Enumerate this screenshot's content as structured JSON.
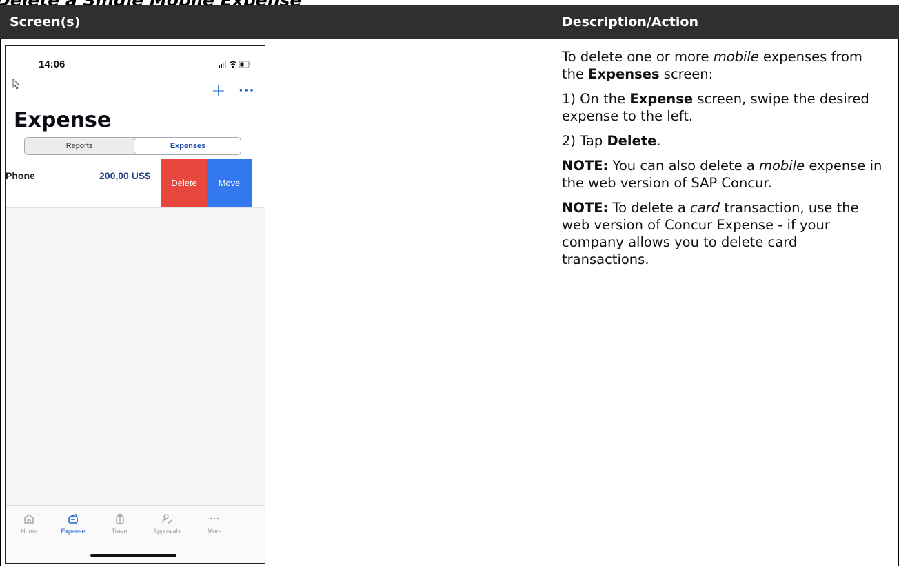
{
  "section_heading": "Delete a Single Mobile Expense",
  "table": {
    "col1_header": "Screen(s)",
    "col2_header": "Description/Action"
  },
  "phone": {
    "status_time": "14:06",
    "title": "Expense",
    "segments": {
      "reports": "Reports",
      "expenses": "Expenses"
    },
    "expense_row": {
      "name": "Phone",
      "amount": "200,00 US$",
      "delete_label": "Delete",
      "move_label": "Move"
    },
    "tabs": [
      {
        "label": "Home",
        "icon": "home-icon"
      },
      {
        "label": "Expense",
        "icon": "expense-card-icon"
      },
      {
        "label": "Travel",
        "icon": "suitcase-icon"
      },
      {
        "label": "Approvals",
        "icon": "approvals-person-icon"
      },
      {
        "label": "More",
        "icon": "more-dots-icon"
      }
    ],
    "colors": {
      "accent": "#1f5fce",
      "delete": "#e8473e",
      "move": "#3478f0"
    }
  },
  "description": {
    "p1": {
      "a": "To delete one or more ",
      "b_italic": "mobile",
      "c": " expenses from the ",
      "d_bold": "Expenses",
      "e": " screen:"
    },
    "p2": {
      "a": "1) On the ",
      "b_bold": "Expense",
      "c": " screen, swipe the desired expense to the left."
    },
    "p3": {
      "a": "2) Tap ",
      "b_bold": "Delete",
      "c": "."
    },
    "p4": {
      "a_bold": "NOTE:",
      "b": " You can also delete a ",
      "c_italic": "mobile",
      "d": " expense in the web version of SAP Concur."
    },
    "p5": {
      "a_bold": "NOTE:",
      "b": " To delete a ",
      "c_italic": "card",
      "d": " transaction, use the web version of Concur Expense - if your company allows you to delete card transactions."
    }
  }
}
